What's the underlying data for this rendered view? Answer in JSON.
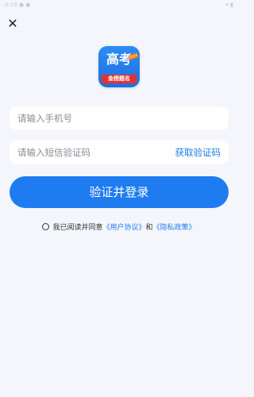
{
  "status": {
    "left": "6:18 ● ●",
    "right": "▾ ▮"
  },
  "close_icon_glyph": "✕",
  "logo": {
    "main": "高考",
    "year": "2024",
    "sub": "金榜题名"
  },
  "phone": {
    "placeholder": "请输入手机号"
  },
  "code": {
    "placeholder": "请输入短信验证码",
    "action": "获取验证码"
  },
  "submit_label": "验证并登录",
  "agreement": {
    "prefix": "我已阅读并同意",
    "user_agreement": "《用户协议》",
    "and": "和",
    "privacy_policy": "《隐私政策》"
  },
  "colors": {
    "accent": "#1e7cf0",
    "background": "#f4f6fb"
  }
}
